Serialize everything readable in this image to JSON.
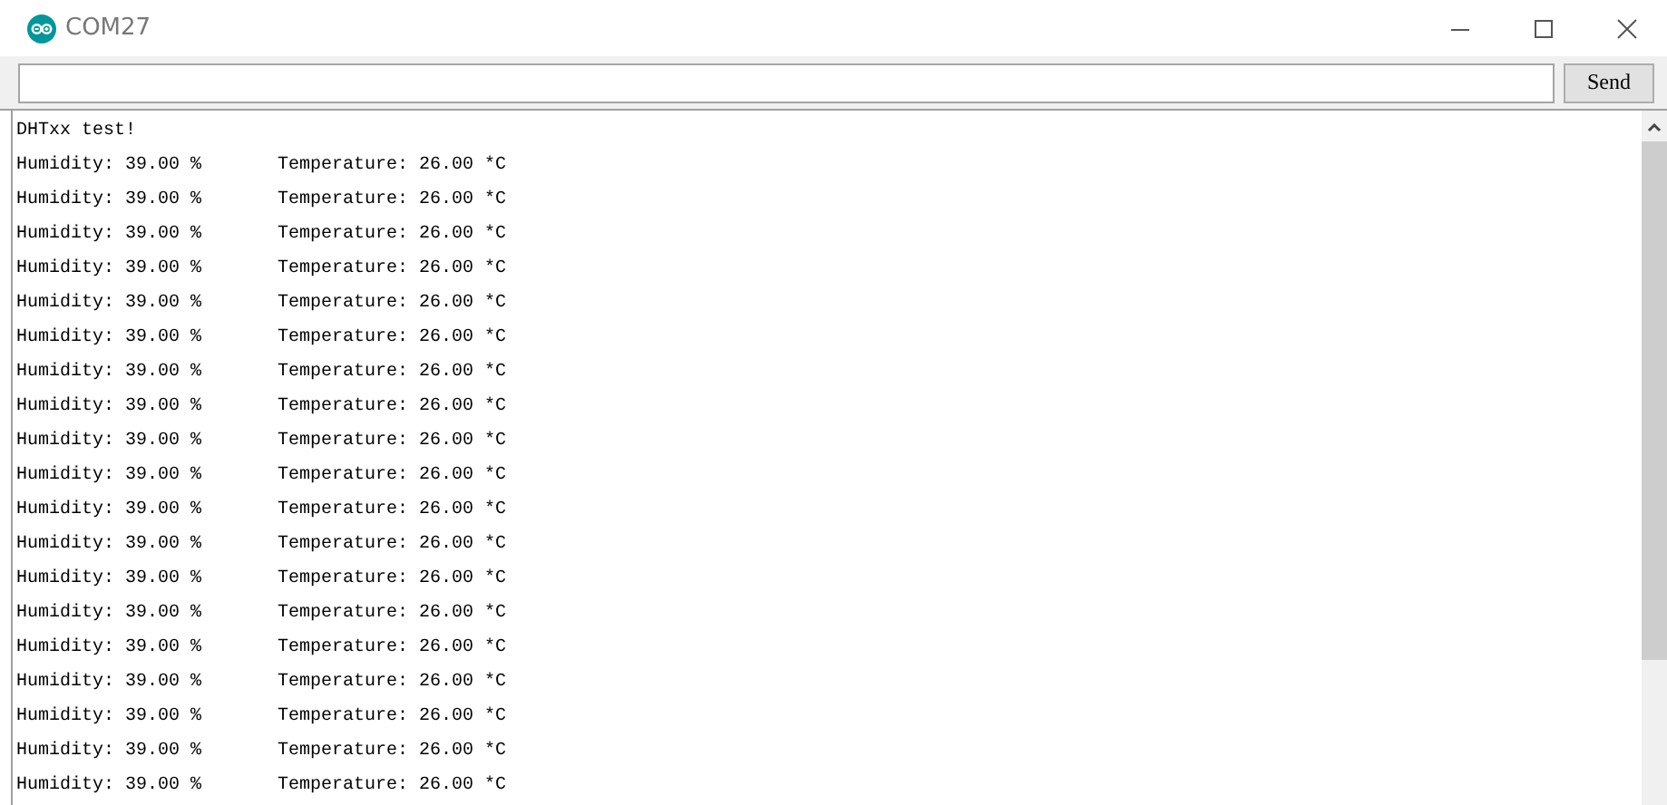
{
  "window": {
    "title": "COM27"
  },
  "send_button": "Send",
  "output_lines": [
    "DHTxx test!",
    "Humidity: 39.00 %       Temperature: 26.00 *C",
    "Humidity: 39.00 %       Temperature: 26.00 *C",
    "Humidity: 39.00 %       Temperature: 26.00 *C",
    "Humidity: 39.00 %       Temperature: 26.00 *C",
    "Humidity: 39.00 %       Temperature: 26.00 *C",
    "Humidity: 39.00 %       Temperature: 26.00 *C",
    "Humidity: 39.00 %       Temperature: 26.00 *C",
    "Humidity: 39.00 %       Temperature: 26.00 *C",
    "Humidity: 39.00 %       Temperature: 26.00 *C",
    "Humidity: 39.00 %       Temperature: 26.00 *C",
    "Humidity: 39.00 %       Temperature: 26.00 *C",
    "Humidity: 39.00 %       Temperature: 26.00 *C",
    "Humidity: 39.00 %       Temperature: 26.00 *C",
    "Humidity: 39.00 %       Temperature: 26.00 *C",
    "Humidity: 39.00 %       Temperature: 26.00 *C",
    "Humidity: 39.00 %       Temperature: 26.00 *C",
    "Humidity: 39.00 %       Temperature: 26.00 *C",
    "Humidity: 39.00 %       Temperature: 26.00 *C",
    "Humidity: 39.00 %       Temperature: 26.00 *C"
  ]
}
